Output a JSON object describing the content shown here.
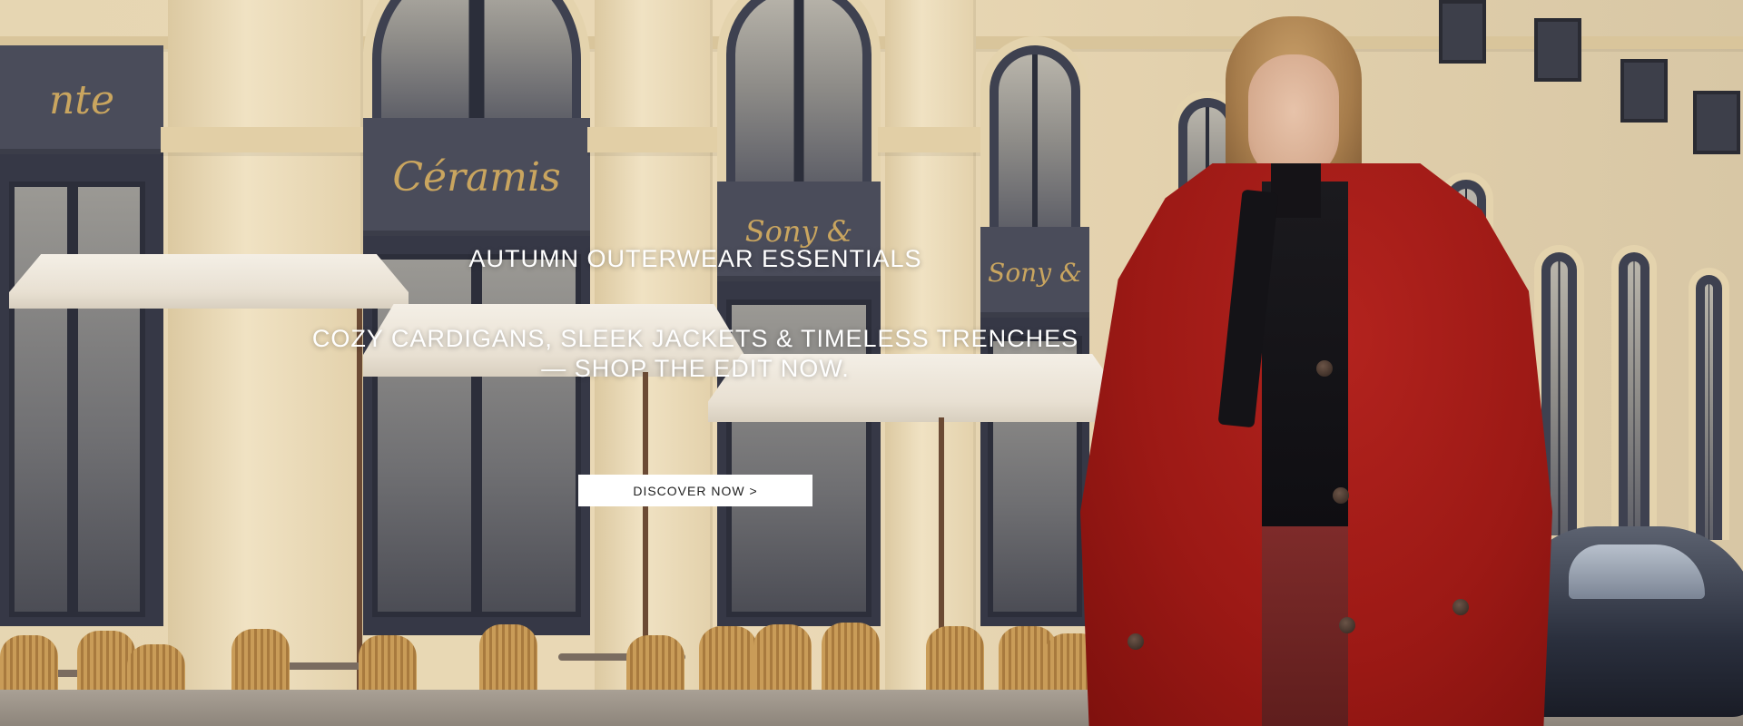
{
  "hero": {
    "eyebrow": "AUTUMN OUTERWEAR ESSENTIALS",
    "headline_line1": "COZY CARDIGANS, SLEEK JACKETS & TIMELESS TRENCHES",
    "headline_line2": "— SHOP THE EDIT NOW.",
    "cta_label": "DISCOVER NOW >"
  },
  "background": {
    "signs": [
      "nte",
      "Céramis",
      "Sony &",
      "Sony &"
    ],
    "accent_color": "#a61c17"
  }
}
